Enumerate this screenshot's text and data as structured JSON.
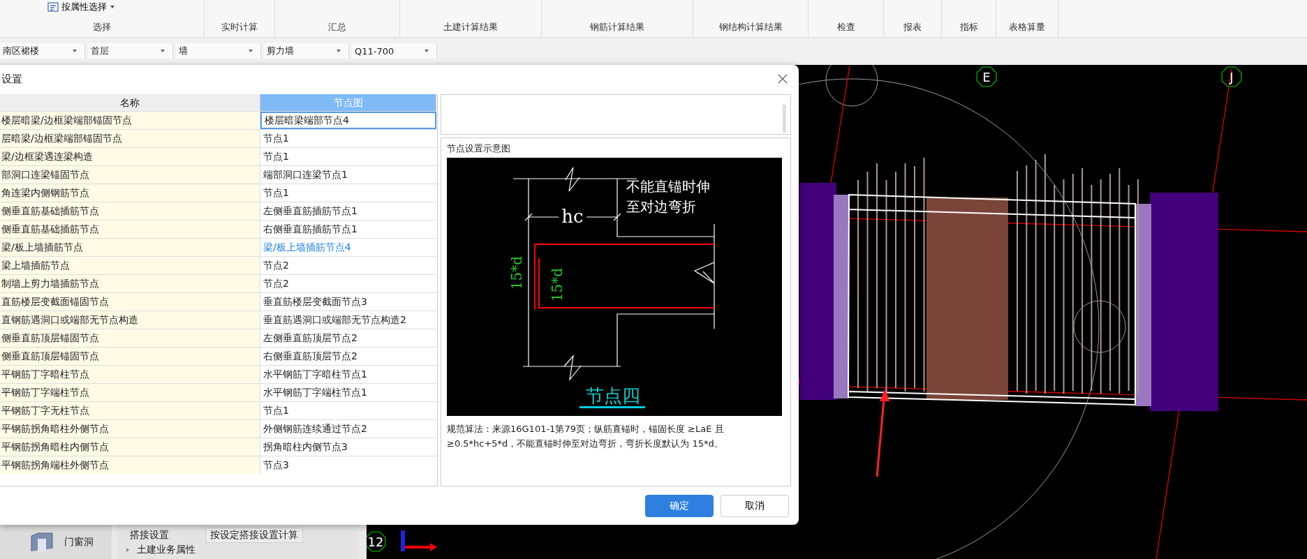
{
  "ribbon": {
    "tool": "按属性选择",
    "groups": [
      {
        "label": "选择"
      },
      {
        "label": "实时计算"
      },
      {
        "label": "汇总"
      },
      {
        "label": "土建计算结果"
      },
      {
        "label": "钢筋计算结果"
      },
      {
        "label": "钢结构计算结果"
      },
      {
        "label": "检查"
      },
      {
        "label": "报表"
      },
      {
        "label": "指标"
      },
      {
        "label": "表格算量"
      }
    ]
  },
  "toolbar": {
    "dropdowns": [
      "南区裙楼",
      "首层",
      "墙",
      "剪力墙",
      "Q11-700"
    ]
  },
  "dialog": {
    "title": "设置",
    "columns": [
      "名称",
      "节点图"
    ],
    "rows": [
      {
        "name": "楼层暗梁/边框梁端部锚固节点",
        "node": "楼层暗梁端部节点4",
        "selected": true,
        "modified": false
      },
      {
        "name": "层暗梁/边框梁端部锚固节点",
        "node": "节点1",
        "selected": false,
        "modified": false
      },
      {
        "name": "梁/边框梁遇连梁构造",
        "node": "节点1",
        "selected": false,
        "modified": false
      },
      {
        "name": "部洞口连梁锚固节点",
        "node": "端部洞口连梁节点1",
        "selected": false,
        "modified": false
      },
      {
        "name": "角连梁内侧钢筋节点",
        "node": "节点1",
        "selected": false,
        "modified": false
      },
      {
        "name": "侧垂直筋基础插筋节点",
        "node": "左侧垂直筋插筋节点1",
        "selected": false,
        "modified": false
      },
      {
        "name": "侧垂直筋基础插筋节点",
        "node": "右侧垂直筋插筋节点1",
        "selected": false,
        "modified": false
      },
      {
        "name": "梁/板上墙插筋节点",
        "node": "梁/板上墙插筋节点4",
        "selected": false,
        "modified": true
      },
      {
        "name": "梁上墙插筋节点",
        "node": "节点2",
        "selected": false,
        "modified": false
      },
      {
        "name": "制墙上剪力墙插筋节点",
        "node": "节点2",
        "selected": false,
        "modified": false
      },
      {
        "name": "直筋楼层变截面锚固节点",
        "node": "垂直筋楼层变截面节点3",
        "selected": false,
        "modified": false
      },
      {
        "name": "直钢筋遇洞口或端部无节点构造",
        "node": "垂直筋遇洞口或端部无节点构造2",
        "selected": false,
        "modified": false
      },
      {
        "name": "侧垂直筋顶层锚固节点",
        "node": "左侧垂直筋顶层节点2",
        "selected": false,
        "modified": false
      },
      {
        "name": "侧垂直筋顶层锚固节点",
        "node": "右侧垂直筋顶层节点2",
        "selected": false,
        "modified": false
      },
      {
        "name": "平钢筋丁字暗柱节点",
        "node": "水平钢筋丁字暗柱节点1",
        "selected": false,
        "modified": false
      },
      {
        "name": "平钢筋丁字端柱节点",
        "node": "水平钢筋丁字端柱节点1",
        "selected": false,
        "modified": false
      },
      {
        "name": "平钢筋丁字无柱节点",
        "node": "节点1",
        "selected": false,
        "modified": false
      },
      {
        "name": "平钢筋拐角暗柱外侧节点",
        "node": "外侧钢筋连续通过节点2",
        "selected": false,
        "modified": false
      },
      {
        "name": "平钢筋拐角暗柱内侧节点",
        "node": "拐角暗柱内侧节点3",
        "selected": false,
        "modified": false
      },
      {
        "name": "平钢筋拐角端柱外侧节点",
        "node": "节点3",
        "selected": false,
        "modified": false
      }
    ],
    "preview": {
      "title": "节点设置示意图",
      "diagram": {
        "note_lines": [
          "不能直锚时伸",
          "至对边弯折"
        ],
        "dimension": "hc",
        "bend_labels": [
          "15*d",
          "15*d"
        ],
        "caption": "节点四"
      },
      "description": "规范算法：来源16G101-1第79页；纵筋直锚时，锚固长度 ≥LaE 且 ≥0.5*hc+5*d，不能直锚时伸至对边弯折，弯折长度默认为 15*d。"
    },
    "buttons": [
      {
        "label": "确定",
        "kind": "primary"
      },
      {
        "label": "取消",
        "kind": "secondary"
      }
    ]
  },
  "side_panel": {
    "category": "门窗洞"
  },
  "properties": {
    "rows": [
      {
        "name": "搭接设置",
        "value": "按设定搭接设置计算"
      }
    ],
    "section": "土建业务属性"
  },
  "canvas": {
    "axis_labels": [
      "E",
      "J",
      "12"
    ]
  }
}
